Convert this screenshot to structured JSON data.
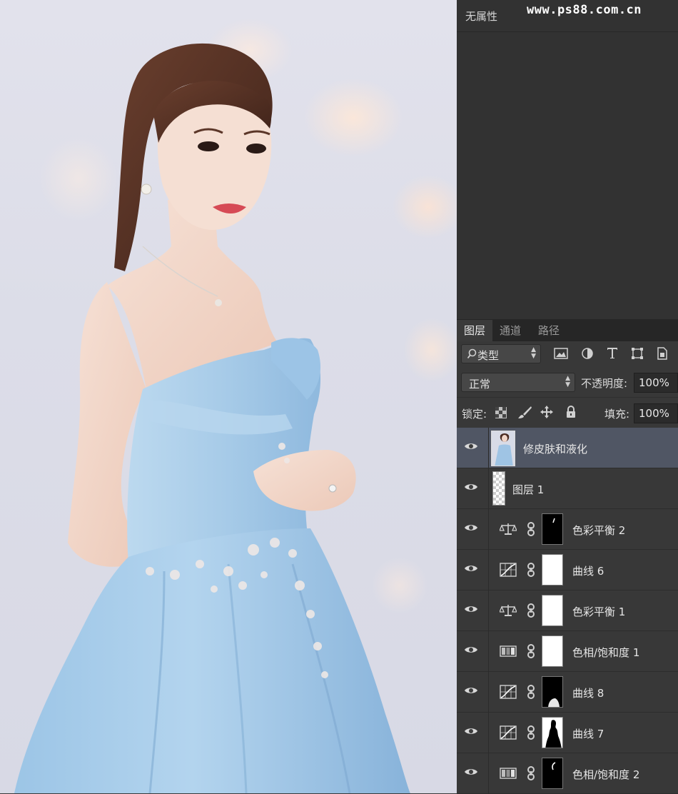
{
  "properties_panel": {
    "title": "无属性"
  },
  "watermark": "www.ps88.com.cn",
  "tabs": [
    {
      "label": "图层",
      "active": true
    },
    {
      "label": "通道",
      "active": false
    },
    {
      "label": "路径",
      "active": false
    }
  ],
  "filter": {
    "label": "类型"
  },
  "blend": {
    "mode": "正常",
    "opacity_label": "不透明度:",
    "opacity": "100%"
  },
  "lock": {
    "label": "锁定:",
    "fill_label": "填充:",
    "fill": "100%"
  },
  "layers": [
    {
      "name": "修皮肤和液化",
      "kind": "pixel-photo",
      "selected": true
    },
    {
      "name": "图层 1",
      "kind": "pixel-empty",
      "selected": false
    },
    {
      "name": "色彩平衡 2",
      "kind": "color-balance",
      "mask": "dark-stroke"
    },
    {
      "name": "曲线 6",
      "kind": "curves",
      "mask": "white"
    },
    {
      "name": "色彩平衡 1",
      "kind": "color-balance",
      "mask": "white"
    },
    {
      "name": "色相/饱和度 1",
      "kind": "hue-saturation",
      "mask": "white"
    },
    {
      "name": "曲线 8",
      "kind": "curves",
      "mask": "dark-shape"
    },
    {
      "name": "曲线 7",
      "kind": "curves",
      "mask": "silhouette"
    },
    {
      "name": "色相/饱和度 2",
      "kind": "hue-saturation",
      "mask": "dark-stroke"
    }
  ],
  "colors": {
    "panel_bg": "#323232",
    "layers_bg": "#383838",
    "selected_layer": "#505664",
    "dress_blue": "#a9cde9"
  }
}
